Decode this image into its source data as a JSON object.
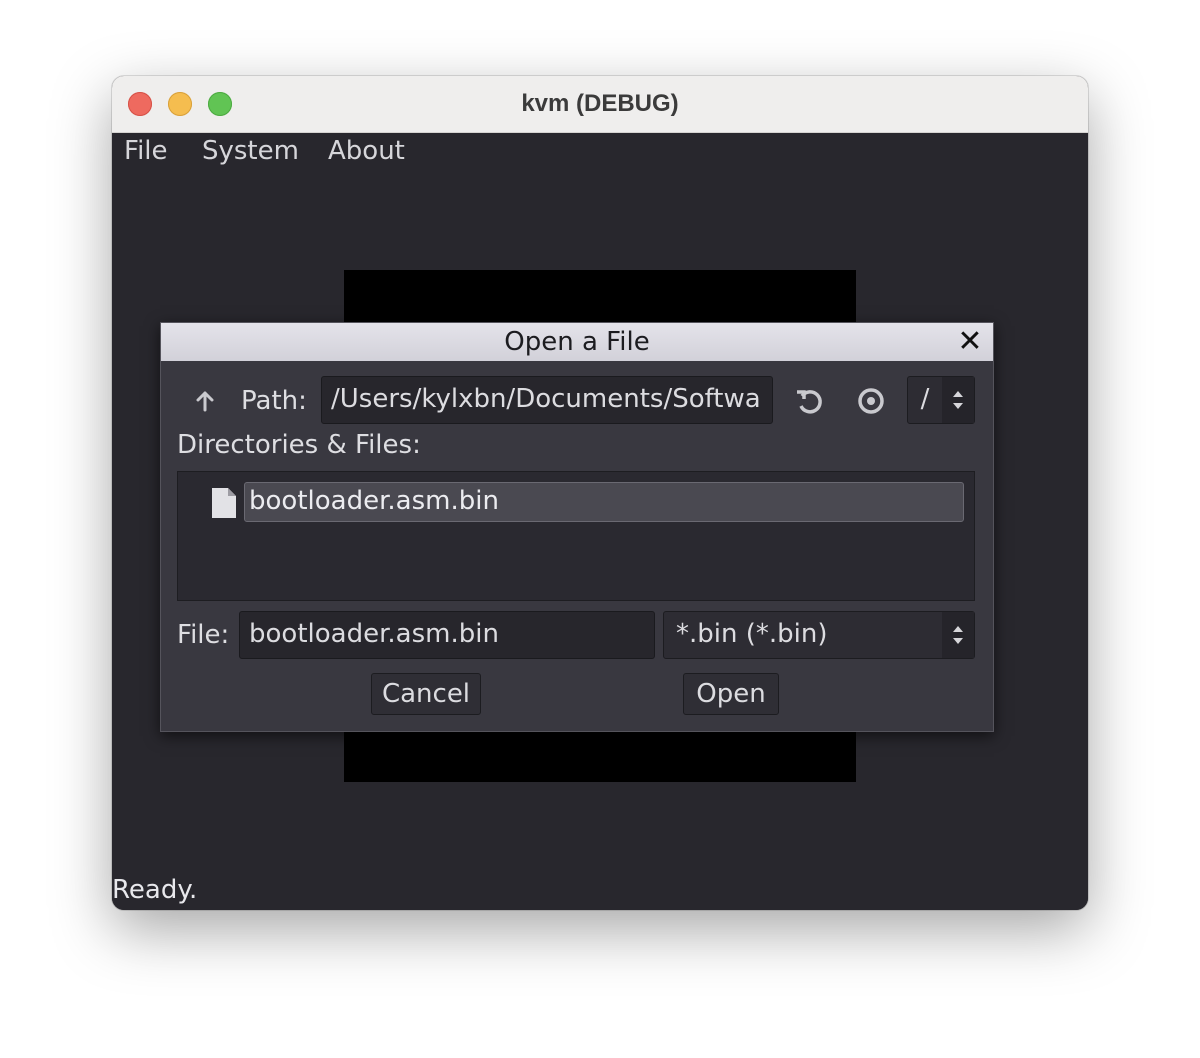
{
  "window": {
    "title": "kvm (DEBUG)"
  },
  "menubar": {
    "items": [
      "File",
      "System",
      "About"
    ]
  },
  "status": "Ready.",
  "dialog": {
    "title": "Open a File",
    "path_label": "Path:",
    "path_value": "/Users/kylxbn/Documents/Softwa",
    "drive_value": "/",
    "list_label": "Directories & Files:",
    "files": [
      {
        "name": "bootloader.asm.bin",
        "type": "file",
        "selected": true
      }
    ],
    "file_label": "File:",
    "file_value": "bootloader.asm.bin",
    "filter_value": "*.bin (*.bin)",
    "cancel_label": "Cancel",
    "open_label": "Open"
  },
  "icons": {
    "up": "arrow-up-icon",
    "refresh": "refresh-icon",
    "hidden": "eye-icon",
    "close": "close-icon",
    "file": "file-icon"
  },
  "colors": {
    "background": "#28272d",
    "dialog": "#393840",
    "emulator_screen": "#000000"
  }
}
